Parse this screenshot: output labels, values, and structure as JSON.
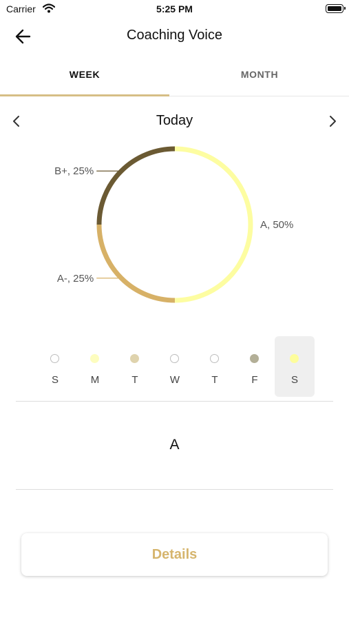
{
  "status_bar": {
    "carrier": "Carrier",
    "time": "5:25 PM"
  },
  "nav": {
    "title": "Coaching Voice"
  },
  "tabs": [
    {
      "label": "WEEK",
      "active": true
    },
    {
      "label": "MONTH",
      "active": false
    }
  ],
  "period": {
    "label": "Today"
  },
  "chart_data": {
    "type": "pie",
    "style": "donut",
    "labels": [
      "A",
      "A-",
      "B+"
    ],
    "values": [
      50,
      25,
      25
    ],
    "data_labels": [
      "A, 50%",
      "A-, 25%",
      "B+, 25%"
    ],
    "colors": [
      "#fdfda1",
      "#d7b167",
      "#6b5a33"
    ]
  },
  "week": {
    "days": [
      {
        "label": "S",
        "color": null,
        "selected": false
      },
      {
        "label": "M",
        "color": "#fdfdbf",
        "selected": false
      },
      {
        "label": "T",
        "color": "#dfd3ad",
        "selected": false
      },
      {
        "label": "W",
        "color": null,
        "selected": false
      },
      {
        "label": "T",
        "color": null,
        "selected": false
      },
      {
        "label": "F",
        "color": "#b3af97",
        "selected": false
      },
      {
        "label": "S",
        "color": "#fdfd9c",
        "selected": true
      }
    ]
  },
  "selected_grade": "A",
  "details_button": {
    "label": "Details"
  },
  "colors": {
    "accent": "#d6be86",
    "button_text": "#d6b56d"
  }
}
